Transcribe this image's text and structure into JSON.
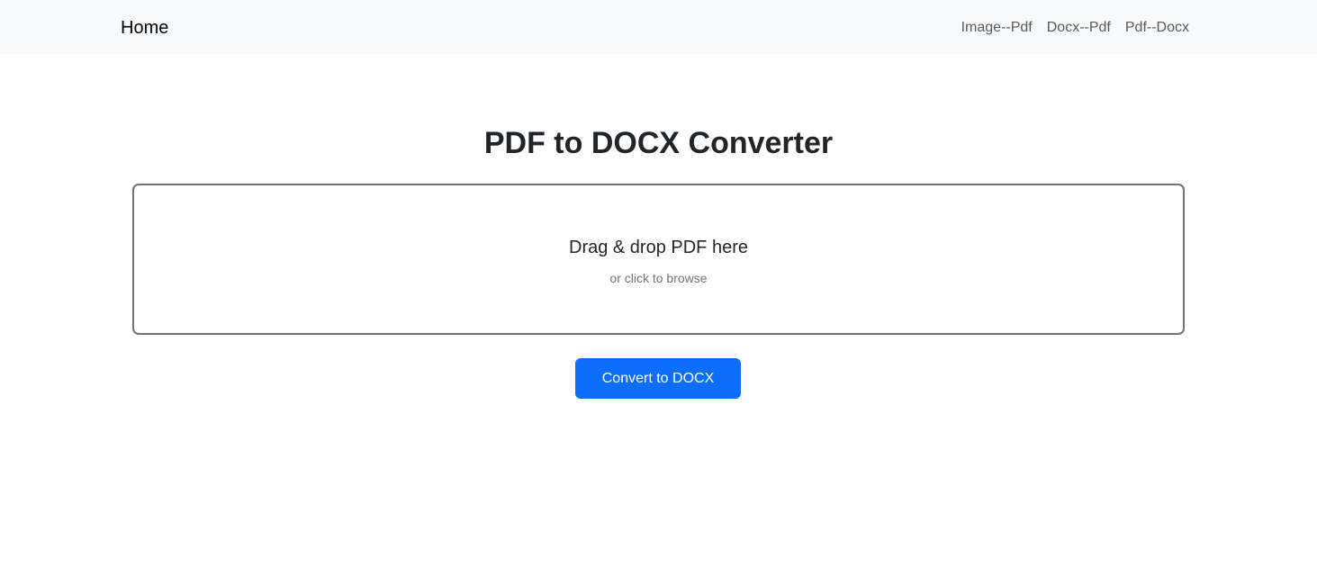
{
  "navbar": {
    "brand": "Home",
    "links": [
      {
        "label": "Image--Pdf"
      },
      {
        "label": "Docx--Pdf"
      },
      {
        "label": "Pdf--Docx"
      }
    ]
  },
  "main": {
    "title": "PDF to DOCX Converter",
    "dropzone": {
      "primary_text": "Drag & drop PDF here",
      "secondary_text": "or click to browse"
    },
    "convert_button_label": "Convert to DOCX"
  },
  "colors": {
    "navbar_bg": "#f8f9fa",
    "primary_button": "#0d6efd",
    "dropzone_border": "#6c757d"
  }
}
